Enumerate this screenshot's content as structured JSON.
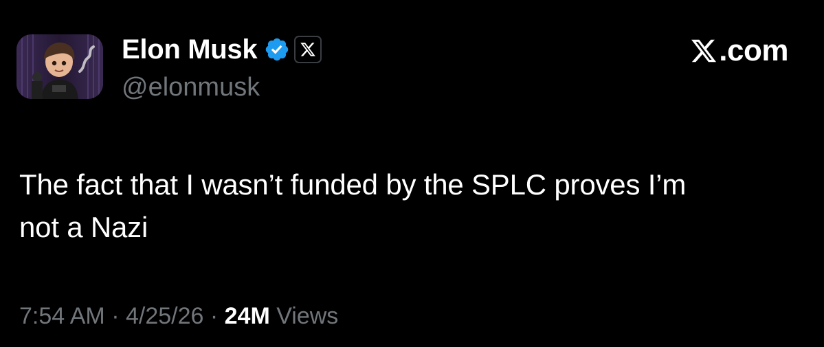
{
  "author": {
    "display_name": "Elon Musk",
    "handle": "@elonmusk",
    "avatar_icon": "avatar-cartoon-portrait",
    "verified_icon": "verified-badge-icon",
    "affiliation_icon": "x-affiliation-icon"
  },
  "brand": {
    "logo_icon": "x-logo-icon",
    "label": ".com"
  },
  "post": {
    "text_lines": [
      "The fact that I wasn’t funded by the SPLC proves I’m",
      "not a Nazi"
    ]
  },
  "meta": {
    "time": "7:54 AM",
    "sep1": " · ",
    "date": "4/25/26",
    "sep2": " · ",
    "views_count": "24M",
    "views_label": " Views"
  },
  "colors": {
    "background": "#000000",
    "primary_text": "#ffffff",
    "secondary_text": "#71767b",
    "verified_blue": "#1d9bf0"
  }
}
